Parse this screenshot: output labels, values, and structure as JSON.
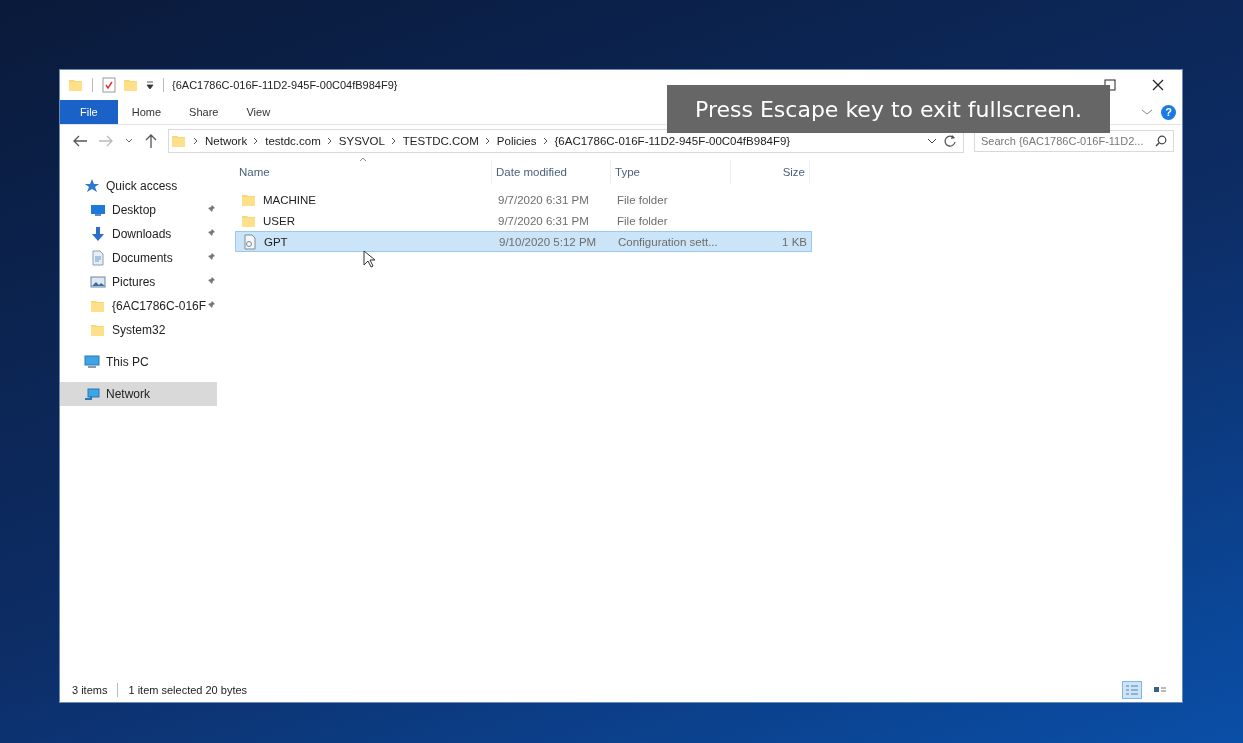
{
  "window": {
    "title": "{6AC1786C-016F-11D2-945F-00C04fB984F9}"
  },
  "ribbon": {
    "tabs": [
      {
        "label": "File",
        "selected": true
      },
      {
        "label": "Home",
        "selected": false
      },
      {
        "label": "Share",
        "selected": false
      },
      {
        "label": "View",
        "selected": false
      }
    ],
    "help": "?"
  },
  "address": {
    "segments": [
      "Network",
      "testdc.com",
      "SYSVOL",
      "TESTDC.COM",
      "Policies",
      "{6AC1786C-016F-11D2-945F-00C04fB984F9}"
    ],
    "search_placeholder": "Search {6AC1786C-016F-11D2..."
  },
  "sidebar": {
    "items": [
      {
        "label": "Quick access",
        "kind": "star",
        "selected": false,
        "children": [
          {
            "label": "Desktop",
            "kind": "desktop",
            "pinned": true,
            "selected": false
          },
          {
            "label": "Downloads",
            "kind": "downloads",
            "pinned": true,
            "selected": false
          },
          {
            "label": "Documents",
            "kind": "documents",
            "pinned": true,
            "selected": false
          },
          {
            "label": "Pictures",
            "kind": "pictures",
            "pinned": true,
            "selected": false
          },
          {
            "label": "{6AC1786C-016F",
            "kind": "folder",
            "pinned": true,
            "selected": false
          },
          {
            "label": "System32",
            "kind": "folder",
            "pinned": false,
            "selected": false
          }
        ]
      },
      {
        "label": "This PC",
        "kind": "pc",
        "selected": false
      },
      {
        "label": "Network",
        "kind": "network",
        "selected": true
      }
    ]
  },
  "table": {
    "columns": [
      "Name",
      "Date modified",
      "Type",
      "Size"
    ],
    "rows": [
      {
        "kind": "folder",
        "name": "MACHINE",
        "date": "9/7/2020 6:31 PM",
        "type": "File folder",
        "selected": false
      },
      {
        "kind": "folder",
        "name": "USER",
        "date": "9/7/2020 6:31 PM",
        "type": "File folder",
        "selected": false
      },
      {
        "kind": "file",
        "name": "GPT",
        "date": "9/10/2020 5:12 PM",
        "type": "Configuration sett...",
        "size": "1 KB",
        "selected": true
      }
    ]
  },
  "status_bar": {
    "count": "3 items",
    "selection": "1 item selected  20 bytes",
    "views": [
      {
        "kind": "details",
        "selected": true
      },
      {
        "kind": "tiles",
        "selected": false
      }
    ]
  },
  "toast": "Press Escape key to exit fullscreen."
}
